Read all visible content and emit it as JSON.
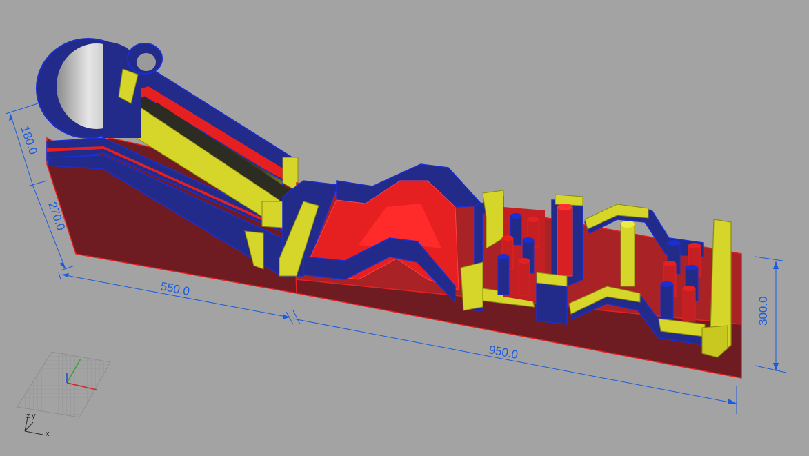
{
  "dimensions": {
    "height_top": "180.0",
    "height_base": "270.0",
    "length_left": "550.0",
    "length_right": "950.0",
    "width": "300.0"
  },
  "axis_labels": {
    "z": "z",
    "y": "y",
    "x": "x"
  },
  "colors": {
    "background": "#a3a3a3",
    "dimension_line": "#1a5ce0",
    "red": "#e62020",
    "dark_red": "#6e1c22",
    "blue": "#222a8a",
    "yellow": "#d6d62a",
    "silver": "#cfcfcf"
  }
}
